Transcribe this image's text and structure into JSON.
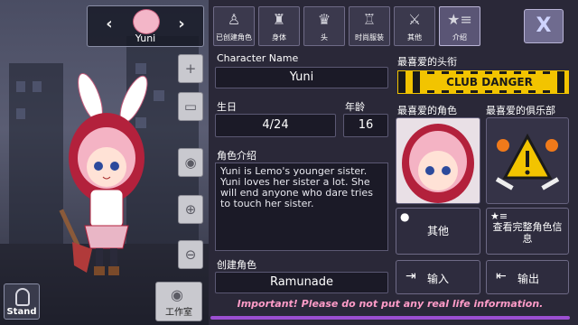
{
  "character_selector": {
    "name": "Yuni",
    "prev_icon": "chevron-left-icon",
    "next_icon": "chevron-right-icon"
  },
  "left_tools": [
    {
      "name": "add-person",
      "icon": "person-plus-icon",
      "glyph": "+"
    },
    {
      "name": "background",
      "icon": "image-icon",
      "glyph": "▭"
    },
    {
      "name": "view",
      "icon": "eye-icon",
      "glyph": "◉"
    },
    {
      "name": "zoom-in",
      "icon": "zoom-in-icon",
      "glyph": "⊕"
    },
    {
      "name": "zoom-out",
      "icon": "zoom-out-icon",
      "glyph": "⊖"
    }
  ],
  "stand_button": {
    "label": "Stand"
  },
  "studio_button": {
    "label": "工作室",
    "glyph": "◉"
  },
  "tabs": [
    {
      "label": "已创建角色",
      "icon": "figure-icon",
      "glyph": "♙"
    },
    {
      "label": "身体",
      "icon": "jacket-icon",
      "glyph": "♜"
    },
    {
      "label": "头",
      "icon": "hair-icon",
      "glyph": "♛"
    },
    {
      "label": "时尚服装",
      "icon": "shirt-icon",
      "glyph": "♖"
    },
    {
      "label": "其他",
      "icon": "sword-icon",
      "glyph": "⚔"
    },
    {
      "label": "介绍",
      "icon": "star-list-icon",
      "glyph": "★≡"
    }
  ],
  "close_button": {
    "glyph": "X"
  },
  "profile": {
    "character_name_label": "Character Name",
    "character_name": "Yuni",
    "birthday_label": "生日",
    "birthday": "4/24",
    "age_label": "年龄",
    "age": "16",
    "intro_label": "角色介绍",
    "intro": "Yuni is Lemo's younger sister. Yuni loves her sister a lot. She will end anyone who dare tries to touch her sister.",
    "creator_label": "创建角色",
    "creator": "Ramunade"
  },
  "favorites": {
    "title_label": "最喜爱的头衔",
    "title_banner": "CLUB DANGER",
    "character_label": "最喜爱的角色",
    "club_label": "最喜爱的俱乐部"
  },
  "actions": {
    "other_label": "其他",
    "view_full_label": "查看完整角色信息",
    "import_label": "输入",
    "export_label": "输出"
  },
  "footer_note": "Important! Please do not put any real life information.",
  "colors": {
    "accent": "#9b4fd1",
    "warning_text": "#ff9cc8",
    "banner_yellow": "#f2c400"
  }
}
